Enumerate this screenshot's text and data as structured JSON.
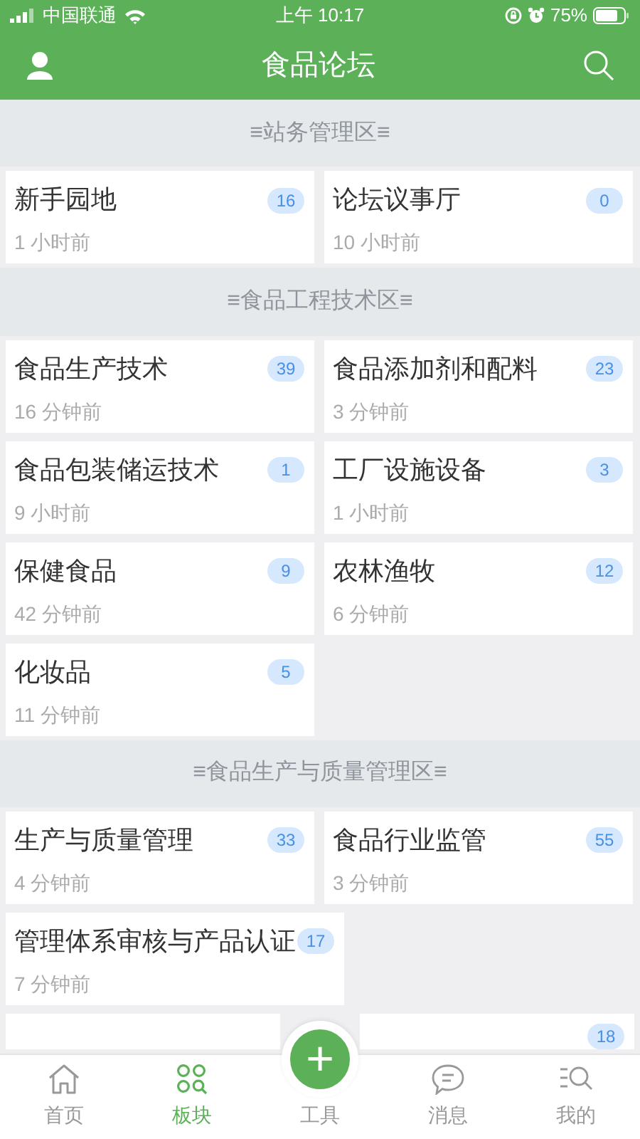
{
  "status_bar": {
    "carrier": "中国联通",
    "time": "上午 10:17",
    "battery": "75%"
  },
  "header": {
    "title": "食品论坛"
  },
  "sections": [
    {
      "title": "≡站务管理区≡",
      "boards": [
        {
          "name": "新手园地",
          "count": "16",
          "updated": "1 小时前"
        },
        {
          "name": "论坛议事厅",
          "count": "0",
          "updated": "10 小时前"
        }
      ]
    },
    {
      "title": "≡食品工程技术区≡",
      "boards": [
        {
          "name": "食品生产技术",
          "count": "39",
          "updated": "16 分钟前"
        },
        {
          "name": "食品添加剂和配料",
          "count": "23",
          "updated": "3 分钟前"
        },
        {
          "name": "食品包装储运技术",
          "count": "1",
          "updated": "9 小时前"
        },
        {
          "name": "工厂设施设备",
          "count": "3",
          "updated": "1 小时前"
        },
        {
          "name": "保健食品",
          "count": "9",
          "updated": "42 分钟前"
        },
        {
          "name": "农林渔牧",
          "count": "12",
          "updated": "6 分钟前"
        },
        {
          "name": "化妆品",
          "count": "5",
          "updated": "11 分钟前"
        }
      ]
    },
    {
      "title": "≡食品生产与质量管理区≡",
      "boards": [
        {
          "name": "生产与质量管理",
          "count": "33",
          "updated": "4 分钟前"
        },
        {
          "name": "食品行业监管",
          "count": "55",
          "updated": "3 分钟前"
        },
        {
          "name": "管理体系审核与产品认证",
          "count": "17",
          "updated": "7 分钟前"
        },
        {
          "kind": "cutleft"
        },
        {
          "count": "18",
          "kind": "cutright"
        }
      ]
    }
  ],
  "fab": {
    "label": "+"
  },
  "tabs": [
    {
      "label": "首页",
      "selected": false
    },
    {
      "label": "板块",
      "selected": true
    },
    {
      "label": "工具",
      "selected": false
    },
    {
      "label": "消息",
      "selected": false
    },
    {
      "label": "我的",
      "selected": false
    }
  ]
}
